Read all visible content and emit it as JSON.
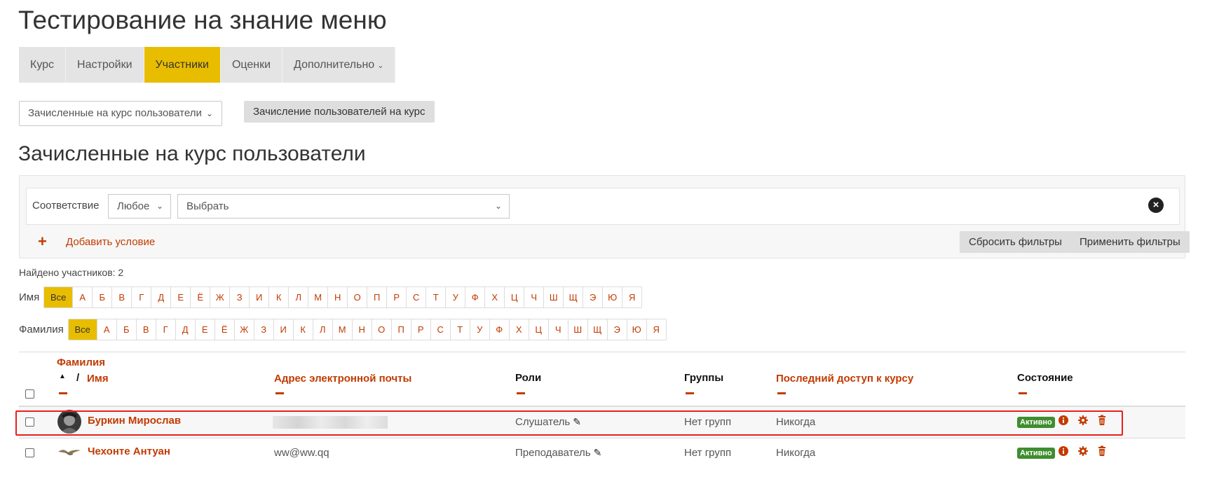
{
  "page_title": "Тестирование на знание меню",
  "tabs": [
    {
      "label": "Курс",
      "active": false
    },
    {
      "label": "Настройки",
      "active": false
    },
    {
      "label": "Участники",
      "active": true
    },
    {
      "label": "Оценки",
      "active": false
    },
    {
      "label": "Дополнительно",
      "active": false
    }
  ],
  "enrol_select": {
    "value": "Зачисленные на курс пользователи"
  },
  "enrol_button": "Зачисление пользователей на курс",
  "section_title": "Зачисленные на курс пользователи",
  "filters": {
    "match_label": "Соответствие",
    "match_value": "Любое",
    "value_placeholder": "Выбрать",
    "add_condition": "Добавить условие",
    "reset": "Сбросить фильтры",
    "apply": "Применить фильтры"
  },
  "found": "Найдено участников: 2",
  "initials_first": {
    "label": "Имя",
    "all": "Все",
    "letters": [
      "А",
      "Б",
      "В",
      "Г",
      "Д",
      "Е",
      "Ё",
      "Ж",
      "З",
      "И",
      "К",
      "Л",
      "М",
      "Н",
      "О",
      "П",
      "Р",
      "С",
      "Т",
      "У",
      "Ф",
      "Х",
      "Ц",
      "Ч",
      "Ш",
      "Щ",
      "Э",
      "Ю",
      "Я"
    ]
  },
  "initials_last": {
    "label": "Фамилия",
    "all": "Все",
    "letters": [
      "А",
      "Б",
      "В",
      "Г",
      "Д",
      "Е",
      "Ё",
      "Ж",
      "З",
      "И",
      "К",
      "Л",
      "М",
      "Н",
      "О",
      "П",
      "Р",
      "С",
      "Т",
      "У",
      "Ф",
      "Х",
      "Ц",
      "Ч",
      "Ш",
      "Щ",
      "Э",
      "Ю",
      "Я"
    ]
  },
  "table": {
    "headers": {
      "lastname": "Фамилия",
      "firstname": "Имя",
      "email": "Адрес электронной почты",
      "roles": "Роли",
      "groups": "Группы",
      "last_access": "Последний доступ к курсу",
      "status": "Состояние"
    },
    "rows": [
      {
        "name": "Буркин Мирослав",
        "email": "",
        "email_hidden": true,
        "role": "Слушатель",
        "groups": "Нет групп",
        "last_access": "Никогда",
        "status": "Активно",
        "highlighted": true
      },
      {
        "name": "Чехонте Антуан",
        "email": "ww@ww.qq",
        "email_hidden": false,
        "role": "Преподаватель",
        "groups": "Нет групп",
        "last_access": "Никогда",
        "status": "Активно",
        "highlighted": false
      }
    ]
  },
  "colors": {
    "accent": "#e8bd00",
    "link": "#c23b00",
    "badge": "#3e8e2e",
    "highlight": "#e8201c"
  }
}
